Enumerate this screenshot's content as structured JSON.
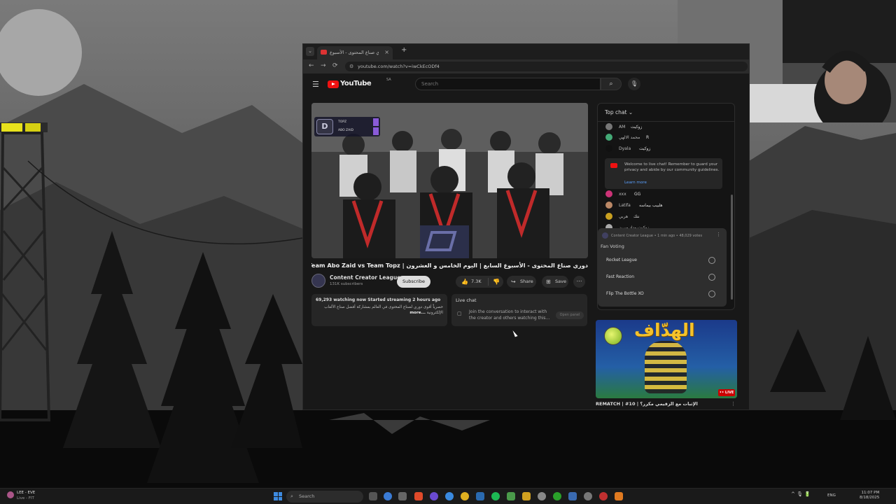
{
  "browser": {
    "tab_title": "دوري صناع المحتوى - الأسبوع",
    "tab_close": "×",
    "new_tab": "+",
    "dropdown": "⌄",
    "back": "←",
    "forward": "→",
    "reload": "⟳",
    "url": "youtube.com/watch?v=iwCkEcODf4"
  },
  "youtube": {
    "menu": "☰",
    "logo_word": "YouTube",
    "country": "SA",
    "search_placeholder": "Search",
    "search_icon": "⌕",
    "mic_icon": "🎙"
  },
  "overlay": {
    "logo": "D",
    "row1": "TOPZ",
    "row2": "ABO ZAID"
  },
  "video": {
    "title": "دوري صناع المحتوى - الأسبوع السابع | اليوم الخامس و العشرون | Team Abo Zaid vs Team Topz",
    "channel_name": "Content Creator League",
    "subscribers": "131K subscribers",
    "subscribe": "Subscribe",
    "like_icon": "👍",
    "likes": "7.3K",
    "dislike_icon": "👎",
    "share_icon": "↪",
    "share": "Share",
    "save_icon": "⊞",
    "save": "Save",
    "more": "⋯"
  },
  "description": {
    "stats": "69,293 watching now  Started streaming 2 hours ago",
    "text": "حصرياً أقوى دوري لصناع المحتوى في العالم بمشاركة أفضل صناع الألعاب الإلكترونية",
    "more": "...more"
  },
  "live_chat_box": {
    "title": "Live chat",
    "icon": "▢",
    "message": "Join the conversation to interact with the creator and others watching this...",
    "button": "Open panel"
  },
  "chat": {
    "header": "Top chat ⌄",
    "messages": [
      {
        "author": "AM",
        "text": "زوكيت",
        "color": "#777"
      },
      {
        "author": "محمد الالهي",
        "text": "R",
        "color": "#4a7"
      },
      {
        "author": "Dyala",
        "text": "زوكيت",
        "color": "#111"
      },
      {
        "author": "xxx",
        "text": "GG",
        "color": "#c37"
      },
      {
        "author": "Latifa",
        "text": "هلبيب بيماسه",
        "color": "#b86"
      },
      {
        "author": "هربي",
        "text": "ننك",
        "color": "#c9a020"
      },
      {
        "author": "زوكيت وداد ميريز",
        "text": "",
        "color": "#aaa"
      }
    ],
    "welcome": {
      "text": "Welcome to live chat! Remember to guard your privacy and abide by our community guidelines.",
      "link": "Learn more"
    },
    "poll": {
      "meta": "Content Creator League • 1 min ago • 48,029 votes",
      "menu": "⋮",
      "question": "Fan Voting",
      "options": [
        "Rocket League",
        "Fast Reaction",
        "Flip The Bottle XO"
      ]
    }
  },
  "recommendation": {
    "title_art": "الهدّاف",
    "live": "•• LIVE",
    "caption": "REMATCH | #10 | الإثبات مع الزقيمي مكرر؟",
    "more": "⋮"
  },
  "taskbar": {
    "widget_line1": "LEE - EVE",
    "widget_line2": "Live - FIT",
    "search_icon": "⌕",
    "search": "Search",
    "tray": "^  🎙  🔋",
    "lang": "ENG",
    "time": "11:07 PM",
    "date": "8/18/2025"
  }
}
